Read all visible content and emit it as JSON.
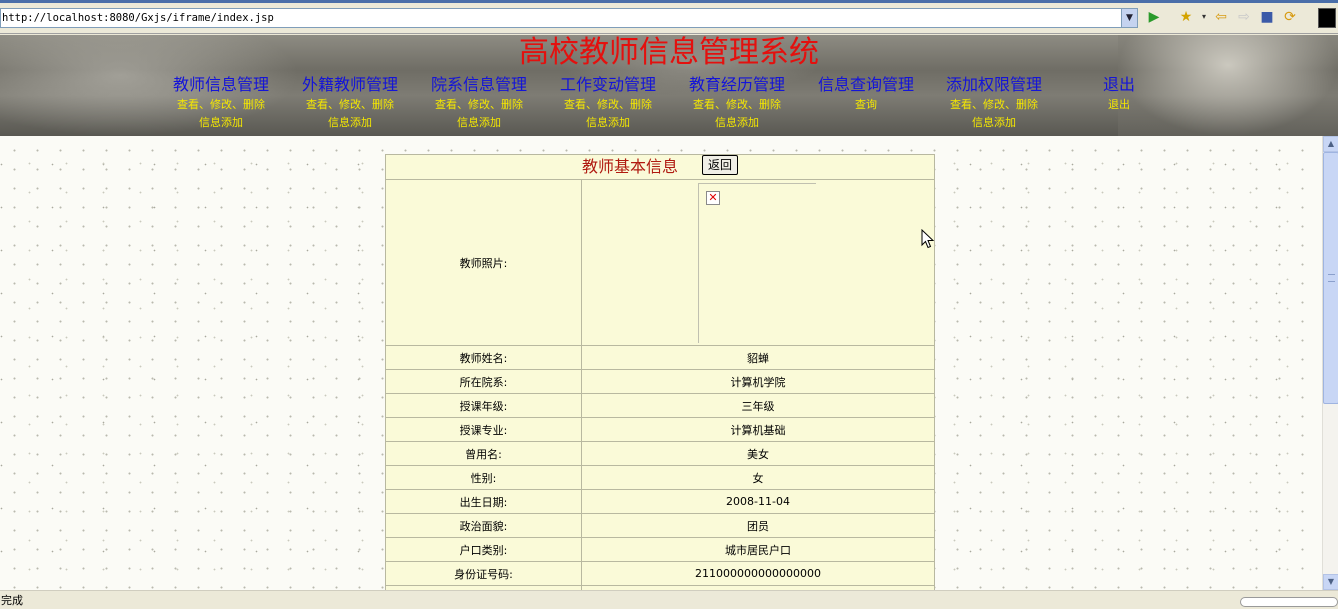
{
  "browser": {
    "url": "http://localhost:8080/Gxjs/iframe/index.jsp",
    "status_text": "完成",
    "icons": [
      "go-icon",
      "favorites-icon",
      "back-icon",
      "forward-icon",
      "stop-icon",
      "refresh-icon"
    ]
  },
  "header": {
    "title": "高校教师信息管理系统",
    "title_color": "#e4100e",
    "menu": [
      {
        "label": "教师信息管理",
        "sub1": "查看、修改、删除",
        "sub2": "信息添加"
      },
      {
        "label": "外籍教师管理",
        "sub1": "查看、修改、删除",
        "sub2": "信息添加"
      },
      {
        "label": "院系信息管理",
        "sub1": "查看、修改、删除",
        "sub2": "信息添加"
      },
      {
        "label": "工作变动管理",
        "sub1": "查看、修改、删除",
        "sub2": "信息添加"
      },
      {
        "label": "教育经历管理",
        "sub1": "查看、修改、删除",
        "sub2": "信息添加"
      },
      {
        "label": "信息查询管理",
        "sub1": "查询",
        "sub2": ""
      },
      {
        "label": "添加权限管理",
        "sub1": "查看、修改、删除",
        "sub2": "信息添加"
      },
      {
        "label": "退出",
        "sub1": "退出",
        "sub2": ""
      }
    ],
    "menu_color": "#1414d8",
    "sub_color": "#f5e800"
  },
  "teacher": {
    "section_title": "教师基本信息",
    "back_label": "返回",
    "photo_label": "教师照片:",
    "fields": [
      {
        "label": "教师姓名:",
        "value": "貂蝉"
      },
      {
        "label": "所在院系:",
        "value": "计算机学院"
      },
      {
        "label": "授课年级:",
        "value": "三年级"
      },
      {
        "label": "授课专业:",
        "value": "计算机基础"
      },
      {
        "label": "曾用名:",
        "value": "美女"
      },
      {
        "label": "性别:",
        "value": "女"
      },
      {
        "label": "出生日期:",
        "value": "2008-11-04"
      },
      {
        "label": "政治面貌:",
        "value": "团员"
      },
      {
        "label": "户口类别:",
        "value": "城市居民户口"
      },
      {
        "label": "身份证号码:",
        "value": "211000000000000000"
      }
    ]
  }
}
